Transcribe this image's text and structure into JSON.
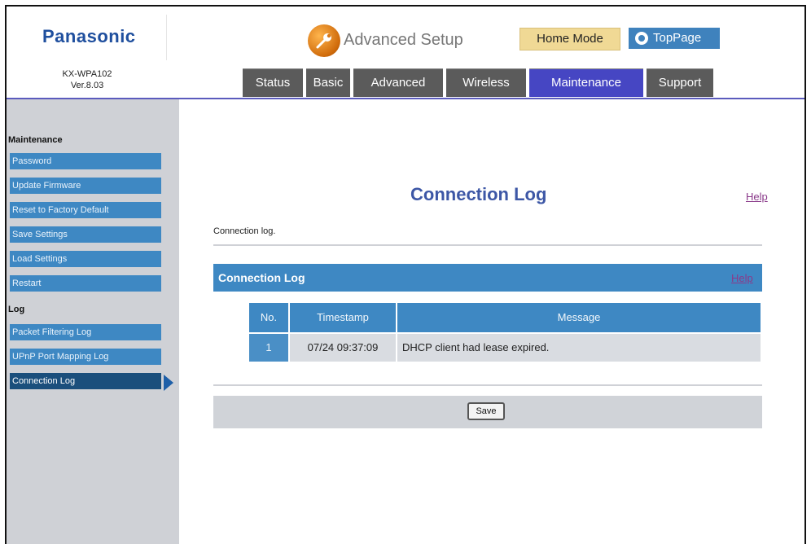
{
  "header": {
    "brand": "Panasonic",
    "model": "KX-WPA102",
    "version": "Ver.8.03",
    "title": "Advanced Setup",
    "home_mode": "Home Mode",
    "top_page": "TopPage"
  },
  "tabs": [
    {
      "label": "Status"
    },
    {
      "label": "Basic"
    },
    {
      "label": "Advanced"
    },
    {
      "label": "Wireless"
    },
    {
      "label": "Maintenance",
      "active": true
    },
    {
      "label": "Support"
    }
  ],
  "sidebar": {
    "maintenance_heading": "Maintenance",
    "maintenance_items": [
      {
        "label": "Password"
      },
      {
        "label": "Update Firmware"
      },
      {
        "label": "Reset to Factory Default"
      },
      {
        "label": "Save Settings"
      },
      {
        "label": "Load Settings"
      },
      {
        "label": "Restart"
      }
    ],
    "log_heading": "Log",
    "log_items": [
      {
        "label": "Packet Filtering Log"
      },
      {
        "label": "UPnP Port Mapping Log"
      },
      {
        "label": "Connection Log",
        "active": true
      }
    ]
  },
  "main": {
    "title": "Connection Log",
    "help": "Help",
    "description": "Connection log.",
    "section_title": "Connection Log",
    "section_help": "Help",
    "table": {
      "headers": [
        "No.",
        "Timestamp",
        "Message"
      ],
      "rows": [
        {
          "no": "1",
          "timestamp": "07/24 09:37:09",
          "message": "DHCP client had lease expired."
        }
      ]
    },
    "save_label": "Save"
  },
  "colors": {
    "accent_blue": "#3e88c3",
    "active_tab": "#4646c3",
    "sidebar_bg": "#cfd1d6",
    "title_blue": "#3d57a6",
    "home_mode_bg": "#f0d995"
  },
  "icons": [
    "wrench-icon",
    "home-circle-icon",
    "arrow-right-icon"
  ]
}
